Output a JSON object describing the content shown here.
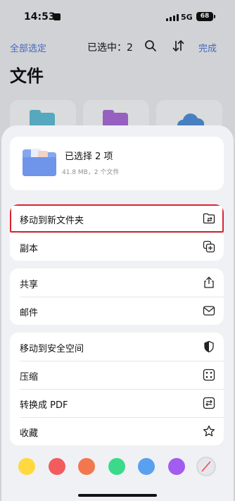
{
  "status_bar": {
    "time": "14:53",
    "network": "5G",
    "battery": "68"
  },
  "top_bar": {
    "select_all": "全部选定",
    "selected_count": "已选中：2",
    "done": "完成"
  },
  "page_title": "文件",
  "sheet": {
    "info": {
      "title": "已选择 2 项",
      "subtitle": "41.8 MB，2 个文件"
    },
    "groups": [
      [
        {
          "label": "移动到新文件夹",
          "icon": "new-folder-icon",
          "highlighted": true
        },
        {
          "label": "副本",
          "icon": "duplicate-icon"
        }
      ],
      [
        {
          "label": "共享",
          "icon": "share-icon"
        },
        {
          "label": "邮件",
          "icon": "mail-icon"
        }
      ],
      [
        {
          "label": "移动到安全空间",
          "icon": "secure-space-icon"
        },
        {
          "label": "压缩",
          "icon": "compress-icon"
        },
        {
          "label": "转换成 PDF",
          "icon": "convert-pdf-icon"
        },
        {
          "label": "收藏",
          "icon": "star-icon"
        }
      ]
    ],
    "tag_colors": [
      "#ffd93d",
      "#f25c5c",
      "#f2774f",
      "#3bd98a",
      "#5aa0f0",
      "#a25df0"
    ]
  },
  "colors": {
    "accent": "#4b74d6",
    "highlight_border": "#d9232d"
  }
}
